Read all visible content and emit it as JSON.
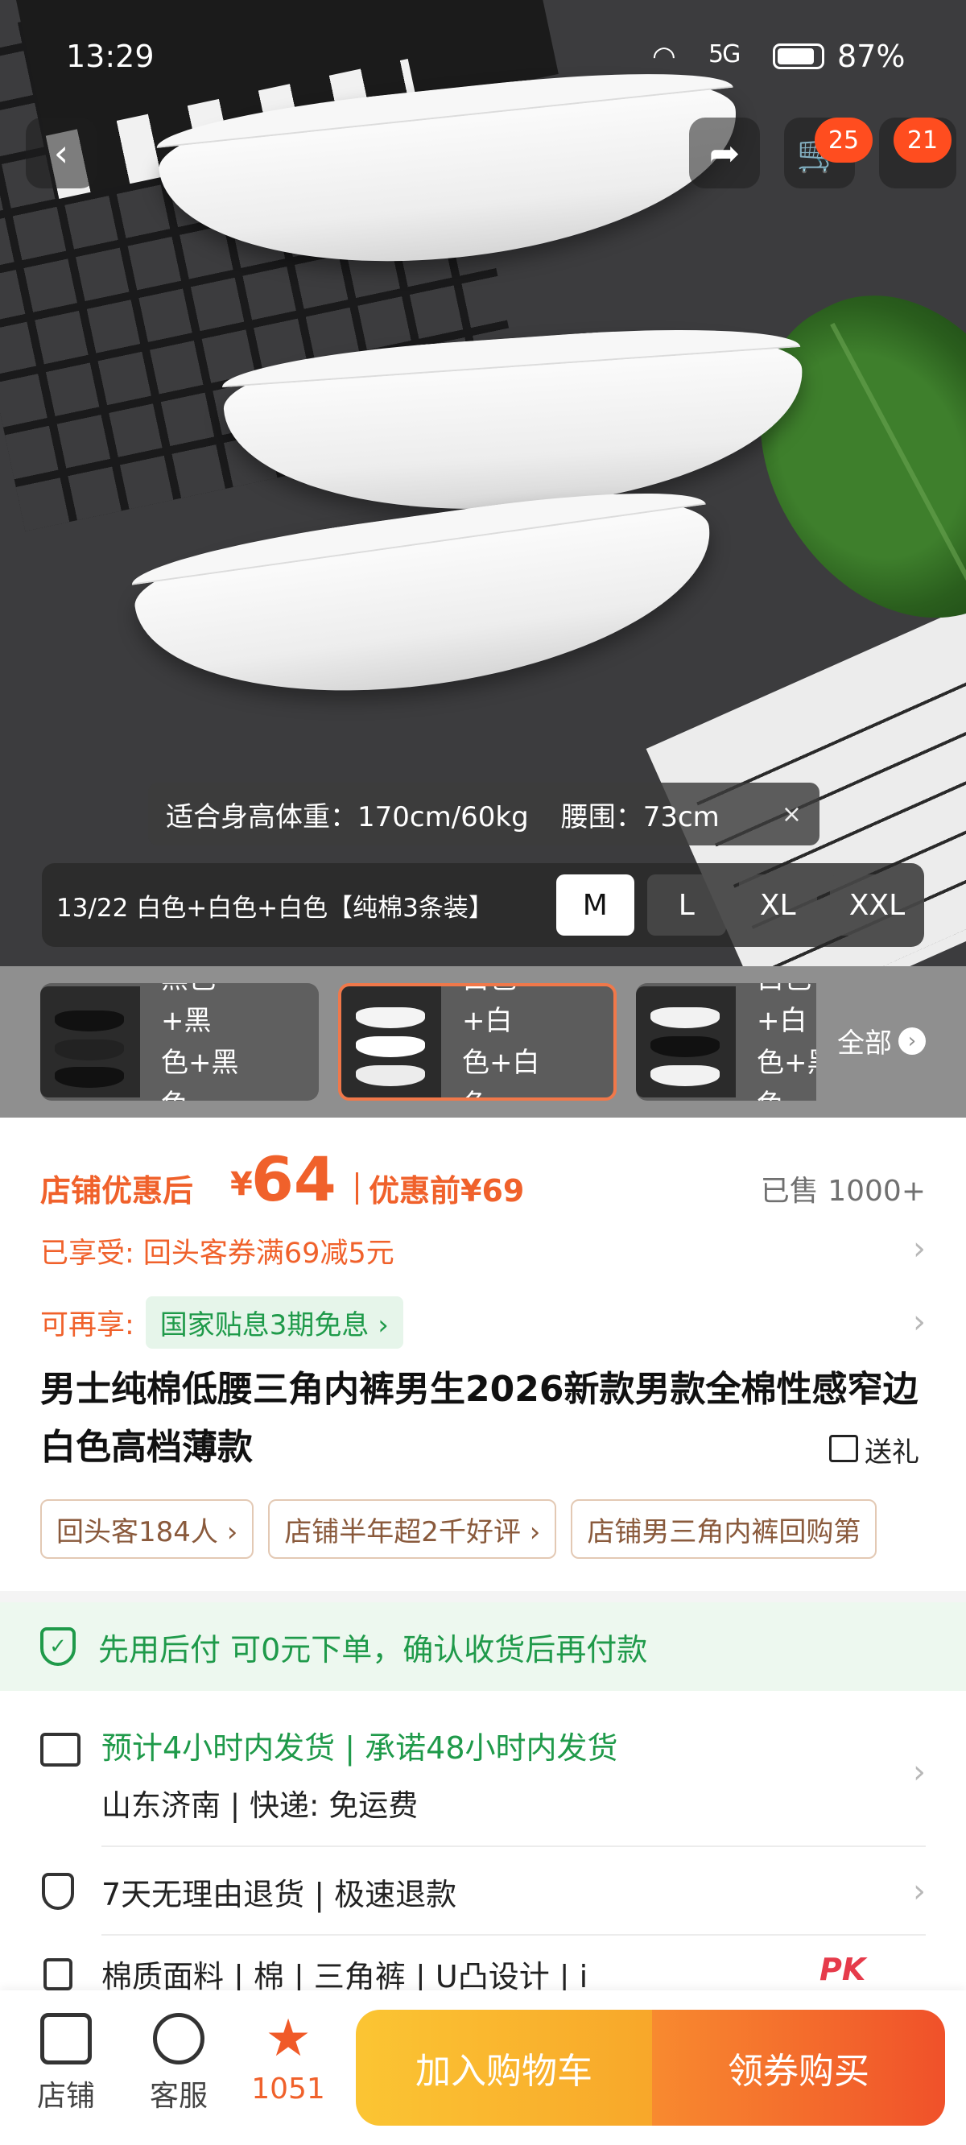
{
  "status_bar": {
    "time": "13:29",
    "network": "5G",
    "battery": "87%"
  },
  "nav": {
    "cart_badge": "25",
    "more_badge": "21"
  },
  "fit_tip": {
    "text": "适合身高体重：170cm/60kg",
    "waist": "腰围：73cm",
    "close": "×"
  },
  "size_bar": {
    "sku": "13/22 白色+白色+白色【纯棉3条装】",
    "sizes": [
      "M",
      "L",
      "XL",
      "XXL"
    ],
    "selected_size": "M"
  },
  "variants": {
    "items": [
      {
        "label": "黑色+黑色+黑色",
        "line1": "黑色+黑",
        "line2": "色+黑色"
      },
      {
        "label": "白色+白色+白色",
        "line1": "白色+白",
        "line2": "色+白色",
        "selected": true
      },
      {
        "label": "白色+白色+黑色",
        "line1": "白色+白",
        "line2": "色+黑色"
      }
    ],
    "all_label": "全部"
  },
  "price": {
    "label": "店铺优惠后",
    "currency": "¥",
    "value": "64",
    "before": "优惠前¥69",
    "sold": "已售 1000+"
  },
  "promos": {
    "enjoyed": "已享受: 回头客券满69减5元",
    "more_label": "可再享:",
    "more_tag": "国家贴息3期免息 ›"
  },
  "product": {
    "title": "男士纯棉低腰三角内裤男生2026新款男款全棉性感窄边白色高档薄款",
    "gift": "送礼"
  },
  "chips": [
    "回头客184人 ›",
    "店铺半年超2千好评 ›",
    "店铺男三角内裤回购第"
  ],
  "pay_after": "先用后付 可0元下单，确认收货后再付款",
  "shipping": {
    "line1": "预计4小时内发货 | 承诺48小时内发货",
    "line2": "山东济南 | 快递: 免运费"
  },
  "returns": "7天无理由退货 | 极速退款",
  "attrs": {
    "text": "棉质面料 | 棉  |  三角裤 | U凸设计  |  i",
    "pk": "PK"
  },
  "bottom": {
    "store": "店铺",
    "service": "客服",
    "fav_count": "1051",
    "add_cart": "加入购物车",
    "buy": "领券购买"
  },
  "colors": {
    "accent": "#f0612b",
    "green": "#1f9a4a",
    "cart": "#fbc533",
    "buy": "#f0512a"
  }
}
